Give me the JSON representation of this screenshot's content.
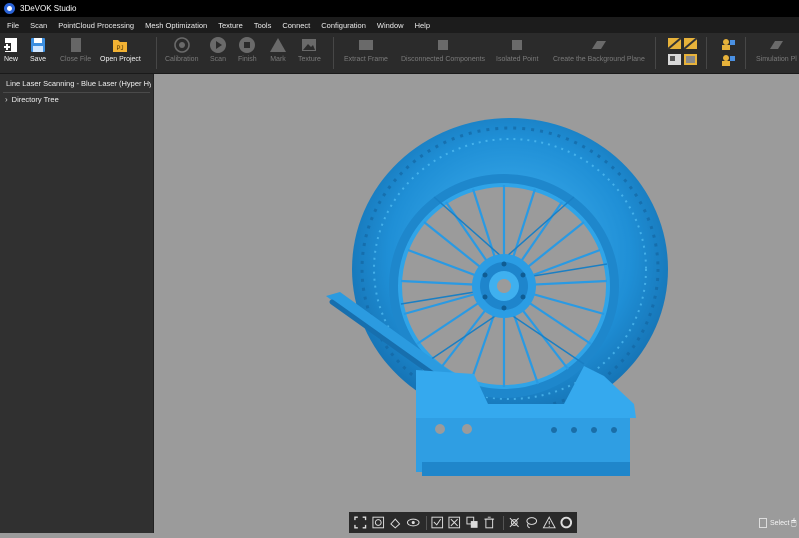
{
  "app": {
    "title": "3DeVOK Studio"
  },
  "menu": [
    "File",
    "Scan",
    "PointCloud Processing",
    "Mesh Optimization",
    "Texture",
    "Tools",
    "Connect",
    "Configuration",
    "Window",
    "Help"
  ],
  "toolbar": {
    "new": "New",
    "save": "Save",
    "close_file": "Close File",
    "open_project": "Open Project",
    "open_project_badge": "PJ",
    "calibration": "Calibration",
    "scan": "Scan",
    "finish": "Finish",
    "mark": "Mark",
    "texture": "Texture",
    "extract_frame": "Extract Frame",
    "disconnected_components": "Disconnected Components",
    "isolated_point": "Isolated Point",
    "create_background_plane": "Create the Background Plane",
    "simulation": "Simulation Pl"
  },
  "left_panel": {
    "title": "Line Laser Scanning - Blue Laser (Hyper Hy",
    "tree_item": "Directory Tree"
  },
  "status": {
    "select_label": "Select"
  },
  "colors": {
    "model": "#1e8fd6",
    "viewport": "#9b9b9b"
  }
}
